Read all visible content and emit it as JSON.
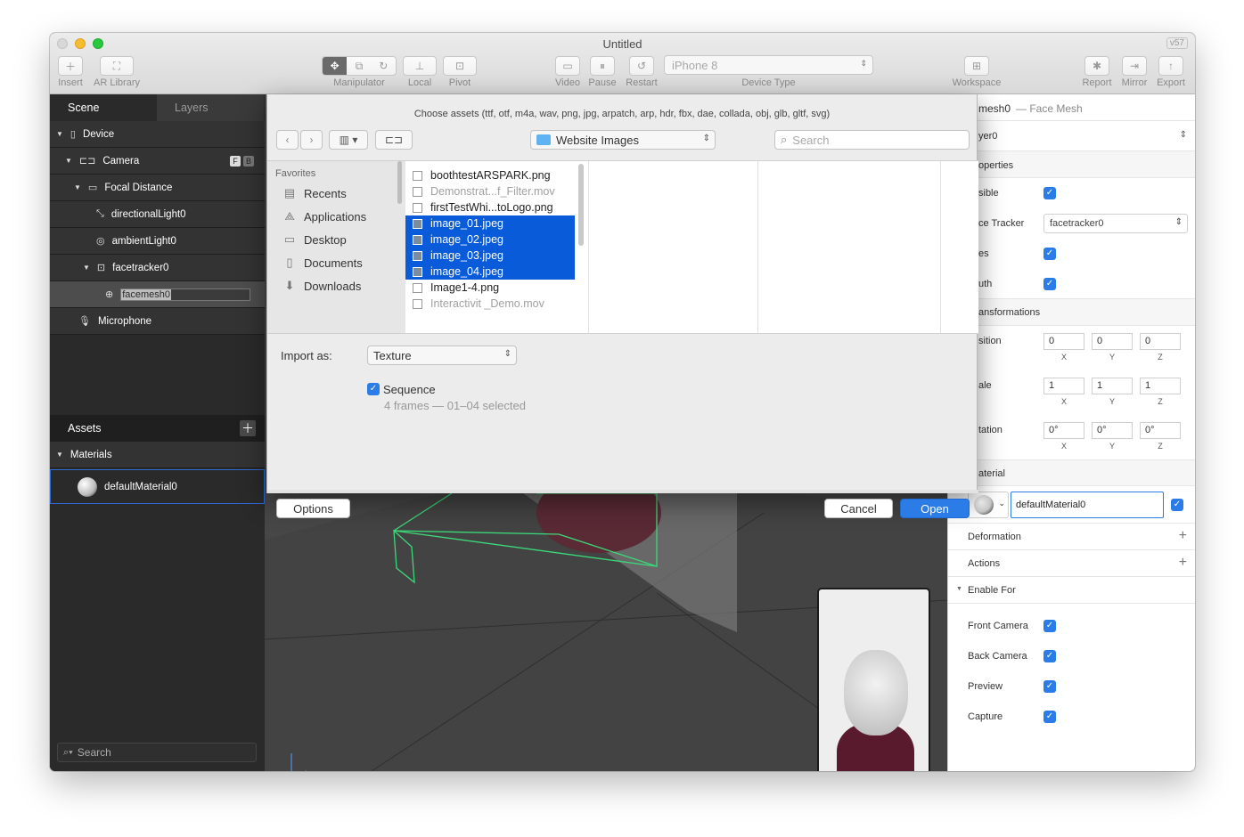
{
  "window": {
    "title": "Untitled",
    "version": "v57"
  },
  "toolbar": {
    "insert": "Insert",
    "ar_library": "AR Library",
    "manipulator": "Manipulator",
    "local": "Local",
    "pivot": "Pivot",
    "video": "Video",
    "pause": "Pause",
    "restart": "Restart",
    "device_type_label": "Device Type",
    "device_type_value": "iPhone 8",
    "workspace": "Workspace",
    "report": "Report",
    "mirror": "Mirror",
    "export": "Export"
  },
  "left": {
    "tabs": [
      "Scene",
      "Layers"
    ],
    "tree": [
      "Device",
      "Camera",
      "Focal Distance",
      "directionalLight0",
      "ambientLight0",
      "facetracker0",
      "facemesh0",
      "Microphone"
    ],
    "camera_badges": [
      "F",
      "B"
    ],
    "assets_title": "Assets",
    "materials_label": "Materials",
    "material_item": "defaultMaterial0",
    "search_placeholder": "Search"
  },
  "right": {
    "title": "mesh0",
    "subtitle": "— Face Mesh",
    "layer": "yer0",
    "properties": "operties",
    "visible": "sible",
    "face_tracker_label": "ce Tracker",
    "face_tracker_value": "facetracker0",
    "eyes": "es",
    "mouth": "uth",
    "transformations": "ansformations",
    "position": "sition",
    "scale": "ale",
    "rotation": "tation",
    "position_values": [
      "0",
      "0",
      "0"
    ],
    "scale_values": [
      "1",
      "1",
      "1"
    ],
    "rotation_values": [
      "0°",
      "0°",
      "0°"
    ],
    "axis_labels": [
      "X",
      "Y",
      "Z"
    ],
    "material": "aterial",
    "material_value": "defaultMaterial0",
    "deformation": "Deformation",
    "actions": "Actions",
    "enable_for": "Enable For",
    "enable_items": [
      "Front Camera",
      "Back Camera",
      "Preview",
      "Capture"
    ]
  },
  "dialog": {
    "title": "Choose assets (ttf, otf, m4a, wav, png, jpg, arpatch, arp, hdr, fbx, dae, collada, obj, glb, gltf, svg)",
    "folder": "Website Images",
    "search_placeholder": "Search",
    "favorites_label": "Favorites",
    "favorites": [
      "Recents",
      "Applications",
      "Desktop",
      "Documents",
      "Downloads"
    ],
    "files": [
      "boothtestARSPARK.png",
      "Demonstrat...f_Filter.mov",
      "firstTestWhi...toLogo.png",
      "image_01.jpeg",
      "image_02.jpeg",
      "image_03.jpeg",
      "image_04.jpeg",
      "Image1-4.png",
      "Interactivit _Demo.mov"
    ],
    "import_as_label": "Import as:",
    "import_as_value": "Texture",
    "sequence_label": "Sequence",
    "sequence_detail": "4 frames — 01–04 selected",
    "options": "Options",
    "cancel": "Cancel",
    "open": "Open"
  },
  "colors": {
    "accent": "#2b7ce6",
    "selection": "#0a5bd9",
    "wireframe": "#3cd97a"
  }
}
